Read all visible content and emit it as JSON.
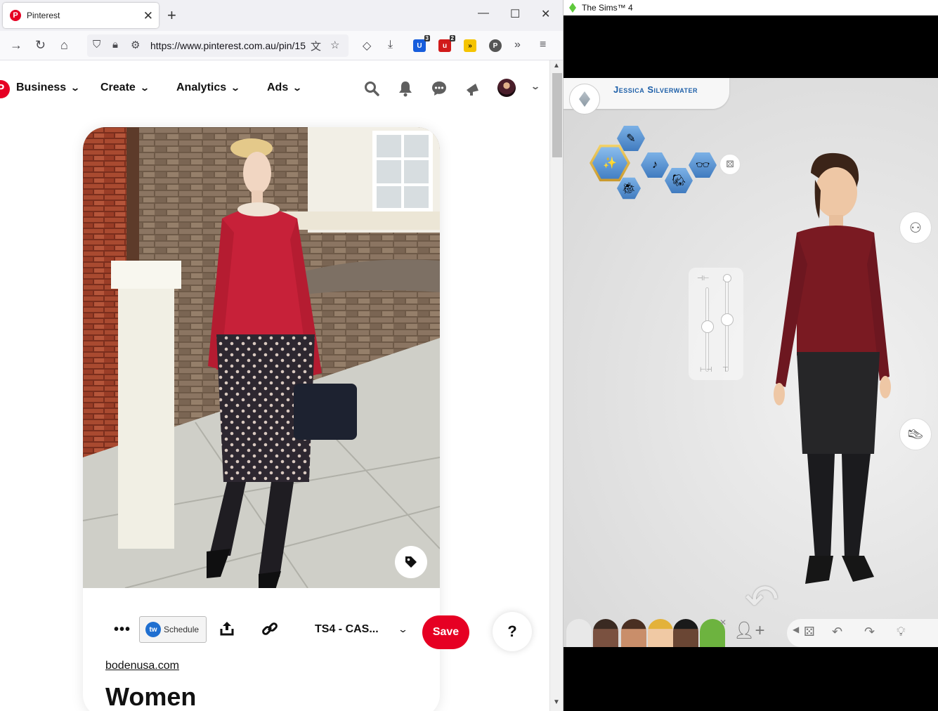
{
  "browser": {
    "tab_title": "Pinterest",
    "tab_icon": "pinterest-icon",
    "url": "https://www.pinterest.com.au/pin/15",
    "extensions": [
      {
        "name": "bitwarden-icon",
        "color": "#175ddc",
        "badge": "3"
      },
      {
        "name": "ublock-icon",
        "color": "#d11a1a",
        "badge": "2"
      },
      {
        "name": "tube-icon",
        "color": "#f5c400",
        "badge": ""
      },
      {
        "name": "pinterest-ext-icon",
        "color": "#555555",
        "badge": ""
      }
    ]
  },
  "pinterest": {
    "brand_color": "#e60023",
    "menu": [
      "Business",
      "Create",
      "Analytics",
      "Ads"
    ],
    "pin": {
      "schedule_label": "Schedule",
      "tw_label": "tw",
      "board": "TS4 - CAS...",
      "save_label": "Save",
      "source": "bodenusa.com",
      "title": "Women"
    },
    "help_label": "?"
  },
  "game": {
    "window_title": "The Sims™ 4",
    "sim_name": "Jessica Silverwater",
    "accent": "#1d5fa8"
  }
}
